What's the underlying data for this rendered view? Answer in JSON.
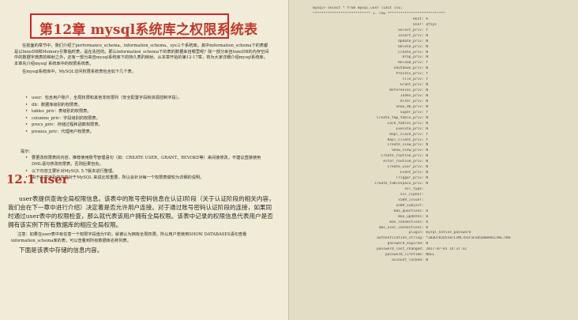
{
  "chapter": {
    "title": "第12章    mysql系统库之权限系统表"
  },
  "intro": [
    "在前面的章节中，我们介绍了performance_schema、information_schema、sys三个系统库。其中information_schema下的表都是以InnoDB和Memory引擎临时表，是在失控的。那么information_schema下的表的数据来自哪里呢？除一部分来自InnoDB的内存空间中的数据字典表的映射之外，还有一部分来自mysql系统库下的持久表的映射。从本章开始的第12-17章，将为大家详细介绍mysql系统库。本章先介绍mysql 系统库中的权限系统表。",
    "在mysql系统库中，MySQL访问权限系统表包含如下几个表。"
  ],
  "bullets": [
    "user：包含用户账户、全局权限和其他非权限列（安全配置字段和资源控制字段）。",
    "db：数据库级别的权限表。",
    "tables_priv：表级别的权限表。",
    "columns_priv：字段级别的权限表。",
    "procs_priv：存储过程和函数权限表。",
    "proxies_priv：代理用户权限表。"
  ],
  "note_head": "提示：",
  "notes": [
    "要更改权限表的内容，推荐使用账号管理语句（如：CREATE USER、GRANT、REVOKE等）来间接修改，不建议直接使用DML语句修改权限表。否则后果自负。",
    "以下内容主要针对MySQL 5.7版本进行整理。",
    "由于本章涉及的内容对于MySQL 来说比较重要，所以会针对每一个权限表做较为详细的说明。"
  ],
  "section": {
    "title": "12.1    user",
    "body": "user表提供查询全局权限信息。该表中的账号密码信息在认证I阶段（关于认证阶段的相关内容，我们会在下一章中进行介绍）决定着是否允许用户连接。对于通过账号密码认证阶段的连接，如果同时通过user表中的权限检查，那么就代表该用户拥有全局权限。该表中记录的权限信息代表用户是否拥有该实例下所有数据库的相应全局权限。",
    "note": "注意：如果在user表中有任意一个权限字段值为Y的，就被认为拥有全局权限，所以用户若使用SHOW DATABASES语句查看information_schema库的表，可以查看到所有数据库名称列表。",
    "end": "下面是该表中存储的信息内容。"
  },
  "code": {
    "command": "mysql> select * from mysql.user limit 1\\G;",
    "separator": "*************************** 1. row ***************************",
    "rows": [
      [
        "Host",
        "%"
      ],
      [
        "User",
        "qfsys"
      ],
      [
        "Select_priv",
        "Y"
      ],
      [
        "Insert_priv",
        "N"
      ],
      [
        "Update_priv",
        "N"
      ],
      [
        "Delete_priv",
        "N"
      ],
      [
        "Create_priv",
        "N"
      ],
      [
        "Drop_priv",
        "N"
      ],
      [
        "Reload_priv",
        "Y"
      ],
      [
        "Shutdown_priv",
        "N"
      ],
      [
        "Process_priv",
        "Y"
      ],
      [
        "File_priv",
        "Y"
      ],
      [
        "Grant_priv",
        "N"
      ],
      [
        "References_priv",
        "N"
      ],
      [
        "Index_priv",
        "N"
      ],
      [
        "Alter_priv",
        "N"
      ],
      [
        "Show_db_priv",
        "N"
      ],
      [
        "Super_priv",
        "Y"
      ],
      [
        "Create_tmp_table_priv",
        "N"
      ],
      [
        "Lock_tables_priv",
        "N"
      ],
      [
        "Execute_priv",
        "N"
      ],
      [
        "Repl_slave_priv",
        "Y"
      ],
      [
        "Repl_client_priv",
        "Y"
      ],
      [
        "Create_view_priv",
        "N"
      ],
      [
        "Show_view_priv",
        "N"
      ],
      [
        "Create_routine_priv",
        "N"
      ],
      [
        "Alter_routine_priv",
        "N"
      ],
      [
        "Create_user_priv",
        "N"
      ],
      [
        "Event_priv",
        "N"
      ],
      [
        "Trigger_priv",
        "N"
      ],
      [
        "Create_tablespace_priv",
        "N"
      ],
      [
        "ssl_type",
        ""
      ],
      [
        "ssl_cipher",
        ""
      ],
      [
        "x509_issuer",
        ""
      ],
      [
        "x509_subject",
        ""
      ],
      [
        "max_questions",
        "0"
      ],
      [
        "max_updates",
        "0"
      ],
      [
        "max_connections",
        "0"
      ],
      [
        "max_user_connections",
        "0"
      ],
      [
        "plugin",
        "mysql_native_password"
      ],
      [
        "authentication_string",
        "*2B3D7D2D5587C1MC7D3F5E5D5D6BAACC96C746F"
      ],
      [
        "password_expired",
        "N"
      ],
      [
        "password_last_changed",
        "2017-07-01 14:37:32"
      ],
      [
        "password_lifetime",
        "NULL"
      ],
      [
        "account_locked",
        "N"
      ]
    ]
  }
}
